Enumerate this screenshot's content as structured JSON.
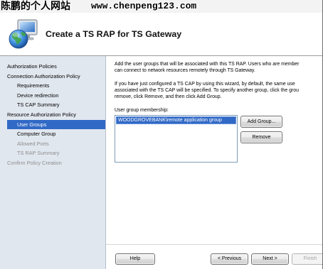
{
  "watermark": {
    "site_name": "陈鹏的个人网站",
    "url": "www.chenpeng123.com"
  },
  "header": {
    "title": "Create a TS RAP for TS Gateway",
    "icon": "globe-computer-icon"
  },
  "nav": {
    "items": [
      {
        "label": "Authorization Policies",
        "state": "normal"
      },
      {
        "label": "Connection Authorization Policy",
        "state": "normal"
      },
      {
        "label": "Requirements",
        "state": "normal"
      },
      {
        "label": "Device redirection",
        "state": "normal"
      },
      {
        "label": "TS CAP Summary",
        "state": "normal"
      },
      {
        "label": "Resource Authorization Policy",
        "state": "normal"
      },
      {
        "label": "User Groups",
        "state": "current"
      },
      {
        "label": "Computer Group",
        "state": "normal"
      },
      {
        "label": "Allowed Ports",
        "state": "disabled"
      },
      {
        "label": "TS RAP Summary",
        "state": "disabled"
      },
      {
        "label": "Confirm Policy Creation",
        "state": "disabled"
      }
    ]
  },
  "content": {
    "intro_lines": [
      "Add the user groups that will be associated with this TS RAP. Users who are member",
      "can connect to network resources remotely through TS Gateway."
    ],
    "note_lines": [
      "If you have just configured a TS CAP by using this wizard, by default, the same use",
      "associated with the TS CAP will be specified. To specify another group, click the grou",
      "remove, click Remove, and then click Add Group."
    ],
    "membership_label": "User group membership:",
    "groups": [
      {
        "name": "WOODGROVEBANK\\remote application group",
        "selected": true
      }
    ],
    "add_group_label": "Add Group...",
    "remove_label": "Remove"
  },
  "footer": {
    "help_label": "Help",
    "previous_label": "< Previous",
    "next_label": "Next >",
    "finish": {
      "label": "Finish",
      "enabled": false
    }
  },
  "colors": {
    "selection": "#3169c6",
    "nav_background": "#e1e7ef",
    "disabled_text": "#8e8e8e"
  }
}
